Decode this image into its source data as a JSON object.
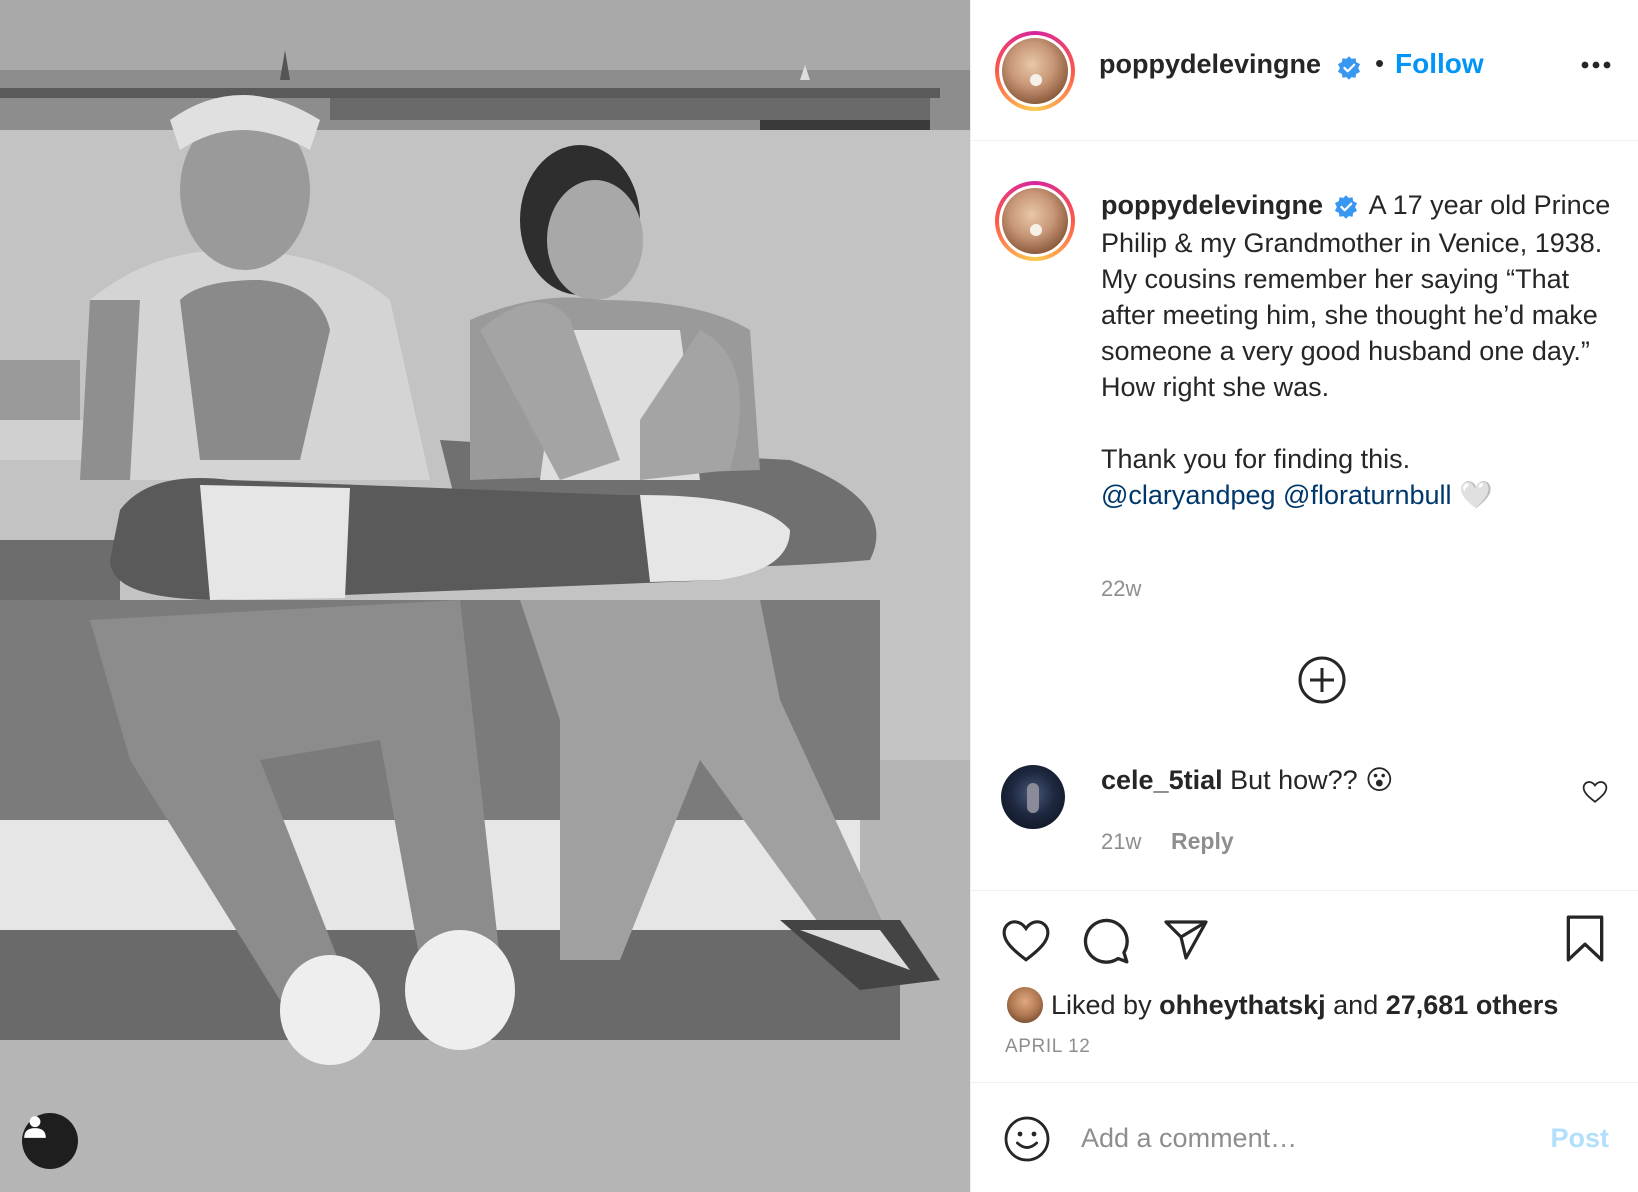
{
  "post": {
    "username": "poppydelevingne",
    "follow_label": "Follow",
    "separator": "•",
    "caption_lines": [
      "A 17 year old Prince Philip & my Grandmother in Venice, 1938. My cousins remember her saying “That after meeting him, she thought he’d make someone a very good husband one day.” How right she was."
    ],
    "caption_thanks": "Thank you for finding this.",
    "mention_1": "@claryandpeg",
    "mention_2": "@floraturnbull",
    "heart_emoji": "🤍",
    "caption_age": "22w",
    "date": "APRIL 12"
  },
  "comment": {
    "username": "cele_5tial",
    "text": "But how?? ",
    "emoji": "😮",
    "age": "21w",
    "reply_label": "Reply"
  },
  "likes": {
    "prefix": "Liked by",
    "liker": "ohheythatskj",
    "joiner": "and",
    "others": "27,681 others"
  },
  "add_comment": {
    "placeholder": "Add a comment…",
    "post_label": "Post"
  },
  "colors": {
    "accent": "#0095f6",
    "verified": "#3897f0",
    "mention": "#00376b",
    "muted": "#8e8e8e",
    "post_disabled": "#b2dffc"
  },
  "icons": [
    "user-tag-icon",
    "verified-icon",
    "more-icon",
    "load-more-icon",
    "heart-icon",
    "comment-icon",
    "share-icon",
    "bookmark-icon",
    "emoji-icon"
  ]
}
